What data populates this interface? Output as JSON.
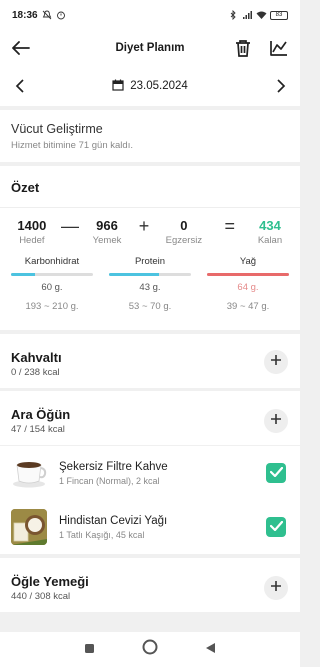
{
  "status": {
    "time": "18:36",
    "battery": "83"
  },
  "appbar": {
    "title": "Diyet Planım"
  },
  "datebar": {
    "date": "23.05.2024"
  },
  "program": {
    "name": "Vücut Geliştirme",
    "sub": "Hizmet bitimine 71 gün kaldı."
  },
  "summary": {
    "head": "Özet",
    "target": {
      "value": "1400",
      "label": "Hedef"
    },
    "food": {
      "value": "966",
      "label": "Yemek"
    },
    "exercise": {
      "value": "0",
      "label": "Egzersiz"
    },
    "remaining": {
      "value": "434",
      "label": "Kalan"
    },
    "op_minus": "—",
    "op_plus": "+",
    "op_equals": "=",
    "macros": [
      {
        "name": "Karbonhidrat",
        "amount": "60 g.",
        "range": "193 ~ 210 g.",
        "progress": 0.29,
        "color": "#4cc3e0",
        "amount_color": "#555555"
      },
      {
        "name": "Protein",
        "amount": "43 g.",
        "range": "53 ~ 70 g.",
        "progress": 0.61,
        "color": "#4cc3e0",
        "amount_color": "#555555"
      },
      {
        "name": "Yağ",
        "amount": "64 g.",
        "range": "39 ~ 47 g.",
        "progress": 1.0,
        "color": "#e86a6a",
        "amount_color": "#e58a8a"
      }
    ]
  },
  "meals": {
    "breakfast": {
      "title": "Kahvaltı",
      "kcal": "0 / 238 kcal"
    },
    "snack": {
      "title": "Ara Öğün",
      "kcal": "47 / 154 kcal"
    },
    "lunch": {
      "title": "Öğle Yemeği",
      "kcal": "440 / 308 kcal"
    }
  },
  "foods": [
    {
      "name": "Şekersiz Filtre Kahve",
      "desc": "1 Fincan (Normal), 2 kcal",
      "icon": "coffee-cup-icon"
    },
    {
      "name": "Hindistan Cevizi Yağı",
      "desc": "1 Tatlı Kaşığı, 45 kcal",
      "icon": "coconut-oil-icon"
    }
  ],
  "colors": {
    "accent": "#2fbf8f",
    "bar_blue": "#4cc3e0",
    "bar_red": "#e86a6a"
  }
}
